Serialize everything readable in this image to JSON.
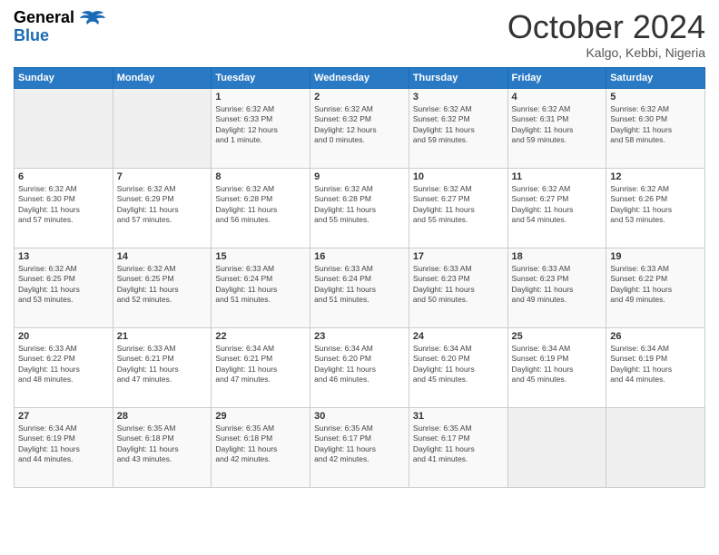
{
  "header": {
    "title": "October 2024",
    "location": "Kalgo, Kebbi, Nigeria"
  },
  "days": [
    "Sunday",
    "Monday",
    "Tuesday",
    "Wednesday",
    "Thursday",
    "Friday",
    "Saturday"
  ],
  "weeks": [
    [
      {
        "day": "",
        "info": ""
      },
      {
        "day": "",
        "info": ""
      },
      {
        "day": "1",
        "info": "Sunrise: 6:32 AM\nSunset: 6:33 PM\nDaylight: 12 hours\nand 1 minute."
      },
      {
        "day": "2",
        "info": "Sunrise: 6:32 AM\nSunset: 6:32 PM\nDaylight: 12 hours\nand 0 minutes."
      },
      {
        "day": "3",
        "info": "Sunrise: 6:32 AM\nSunset: 6:32 PM\nDaylight: 11 hours\nand 59 minutes."
      },
      {
        "day": "4",
        "info": "Sunrise: 6:32 AM\nSunset: 6:31 PM\nDaylight: 11 hours\nand 59 minutes."
      },
      {
        "day": "5",
        "info": "Sunrise: 6:32 AM\nSunset: 6:30 PM\nDaylight: 11 hours\nand 58 minutes."
      }
    ],
    [
      {
        "day": "6",
        "info": "Sunrise: 6:32 AM\nSunset: 6:30 PM\nDaylight: 11 hours\nand 57 minutes."
      },
      {
        "day": "7",
        "info": "Sunrise: 6:32 AM\nSunset: 6:29 PM\nDaylight: 11 hours\nand 57 minutes."
      },
      {
        "day": "8",
        "info": "Sunrise: 6:32 AM\nSunset: 6:28 PM\nDaylight: 11 hours\nand 56 minutes."
      },
      {
        "day": "9",
        "info": "Sunrise: 6:32 AM\nSunset: 6:28 PM\nDaylight: 11 hours\nand 55 minutes."
      },
      {
        "day": "10",
        "info": "Sunrise: 6:32 AM\nSunset: 6:27 PM\nDaylight: 11 hours\nand 55 minutes."
      },
      {
        "day": "11",
        "info": "Sunrise: 6:32 AM\nSunset: 6:27 PM\nDaylight: 11 hours\nand 54 minutes."
      },
      {
        "day": "12",
        "info": "Sunrise: 6:32 AM\nSunset: 6:26 PM\nDaylight: 11 hours\nand 53 minutes."
      }
    ],
    [
      {
        "day": "13",
        "info": "Sunrise: 6:32 AM\nSunset: 6:25 PM\nDaylight: 11 hours\nand 53 minutes."
      },
      {
        "day": "14",
        "info": "Sunrise: 6:32 AM\nSunset: 6:25 PM\nDaylight: 11 hours\nand 52 minutes."
      },
      {
        "day": "15",
        "info": "Sunrise: 6:33 AM\nSunset: 6:24 PM\nDaylight: 11 hours\nand 51 minutes."
      },
      {
        "day": "16",
        "info": "Sunrise: 6:33 AM\nSunset: 6:24 PM\nDaylight: 11 hours\nand 51 minutes."
      },
      {
        "day": "17",
        "info": "Sunrise: 6:33 AM\nSunset: 6:23 PM\nDaylight: 11 hours\nand 50 minutes."
      },
      {
        "day": "18",
        "info": "Sunrise: 6:33 AM\nSunset: 6:23 PM\nDaylight: 11 hours\nand 49 minutes."
      },
      {
        "day": "19",
        "info": "Sunrise: 6:33 AM\nSunset: 6:22 PM\nDaylight: 11 hours\nand 49 minutes."
      }
    ],
    [
      {
        "day": "20",
        "info": "Sunrise: 6:33 AM\nSunset: 6:22 PM\nDaylight: 11 hours\nand 48 minutes."
      },
      {
        "day": "21",
        "info": "Sunrise: 6:33 AM\nSunset: 6:21 PM\nDaylight: 11 hours\nand 47 minutes."
      },
      {
        "day": "22",
        "info": "Sunrise: 6:34 AM\nSunset: 6:21 PM\nDaylight: 11 hours\nand 47 minutes."
      },
      {
        "day": "23",
        "info": "Sunrise: 6:34 AM\nSunset: 6:20 PM\nDaylight: 11 hours\nand 46 minutes."
      },
      {
        "day": "24",
        "info": "Sunrise: 6:34 AM\nSunset: 6:20 PM\nDaylight: 11 hours\nand 45 minutes."
      },
      {
        "day": "25",
        "info": "Sunrise: 6:34 AM\nSunset: 6:19 PM\nDaylight: 11 hours\nand 45 minutes."
      },
      {
        "day": "26",
        "info": "Sunrise: 6:34 AM\nSunset: 6:19 PM\nDaylight: 11 hours\nand 44 minutes."
      }
    ],
    [
      {
        "day": "27",
        "info": "Sunrise: 6:34 AM\nSunset: 6:19 PM\nDaylight: 11 hours\nand 44 minutes."
      },
      {
        "day": "28",
        "info": "Sunrise: 6:35 AM\nSunset: 6:18 PM\nDaylight: 11 hours\nand 43 minutes."
      },
      {
        "day": "29",
        "info": "Sunrise: 6:35 AM\nSunset: 6:18 PM\nDaylight: 11 hours\nand 42 minutes."
      },
      {
        "day": "30",
        "info": "Sunrise: 6:35 AM\nSunset: 6:17 PM\nDaylight: 11 hours\nand 42 minutes."
      },
      {
        "day": "31",
        "info": "Sunrise: 6:35 AM\nSunset: 6:17 PM\nDaylight: 11 hours\nand 41 minutes."
      },
      {
        "day": "",
        "info": ""
      },
      {
        "day": "",
        "info": ""
      }
    ]
  ]
}
